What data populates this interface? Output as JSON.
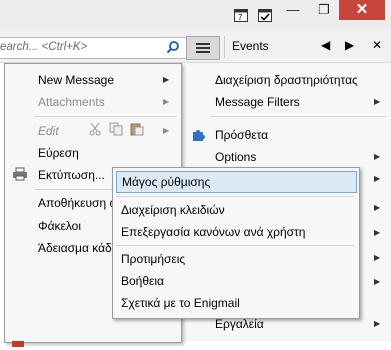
{
  "toolbar": {
    "search_placeholder": "earch... <Ctrl+K>",
    "events_label": "Events"
  },
  "window": {
    "minimize": "—",
    "maximize": "❐",
    "close": "✕"
  },
  "main_menu": {
    "new_message": "New Message",
    "attachments": "Attachments",
    "edit": "Edit",
    "find": "Εύρεση",
    "print": "Εκτύπωση...",
    "save_as": "Αποθήκευση ω",
    "folders": "Φάκελοι",
    "empty_trash": "Άδειασμα κάδ"
  },
  "right_menu": {
    "activity_manager": "Διαχείριση δραστηριότητας",
    "message_filters": "Message Filters",
    "addons": "Πρόσθετα",
    "options": "Options",
    "tools": "Εργαλεία"
  },
  "submenu": {
    "setup_wizard": "Μάγος ρύθμισης",
    "key_management": "Διαχείριση κλειδιών",
    "edit_rules": "Επεξεργασία κανόνων ανά χρήστη",
    "preferences": "Προτιμήσεις",
    "help": "Βοήθεια",
    "about": "Σχετικά με το Enigmail"
  }
}
